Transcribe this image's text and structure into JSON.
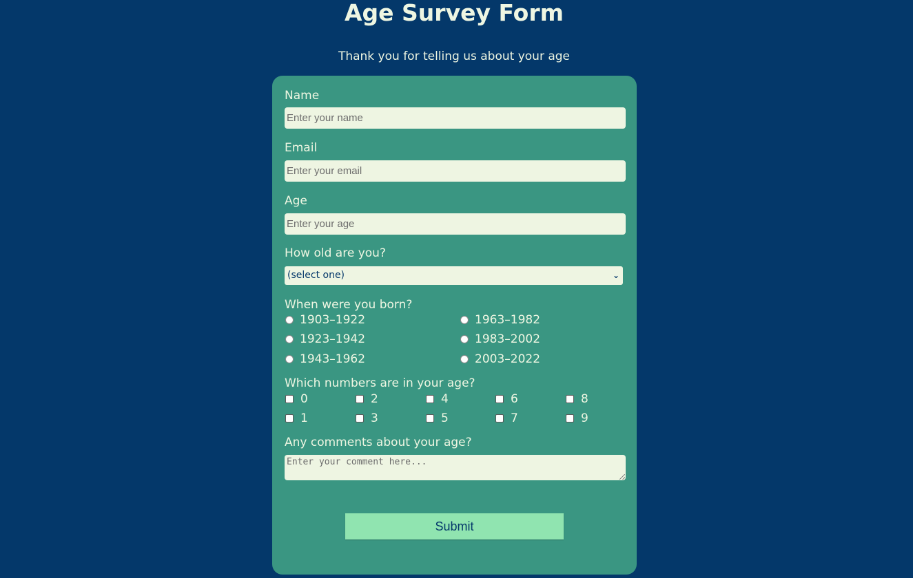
{
  "header": {
    "title": "Age Survey Form",
    "description": "Thank you for telling us about your age"
  },
  "form": {
    "name": {
      "label": "Name",
      "placeholder": "Enter your name"
    },
    "email": {
      "label": "Email",
      "placeholder": "Enter your email"
    },
    "age": {
      "label": "Age",
      "placeholder": "Enter your age"
    },
    "dropdown": {
      "label": "How old are you?",
      "selected": "(select one)"
    },
    "radio_group": {
      "label": "When were you born?",
      "options": [
        "1903–1922",
        "1923–1942",
        "1943–1962",
        "1963–1982",
        "1983–2002",
        "2003–2022"
      ]
    },
    "checkbox_group": {
      "label": "Which numbers are in your age?",
      "options": [
        "0",
        "1",
        "2",
        "3",
        "4",
        "5",
        "6",
        "7",
        "8",
        "9"
      ]
    },
    "comments": {
      "label": "Any comments about your age?",
      "placeholder": "Enter your comment here..."
    },
    "submit_label": "Submit"
  },
  "colors": {
    "page_background": "#04386a",
    "card_background": "#3a9682",
    "input_background": "#eef5e2",
    "button_background": "#90e4b0",
    "text": "#eef6e2"
  },
  "icons": {
    "select_arrow": "chevron-down-icon",
    "textarea_resize": "resize-handle-icon"
  }
}
